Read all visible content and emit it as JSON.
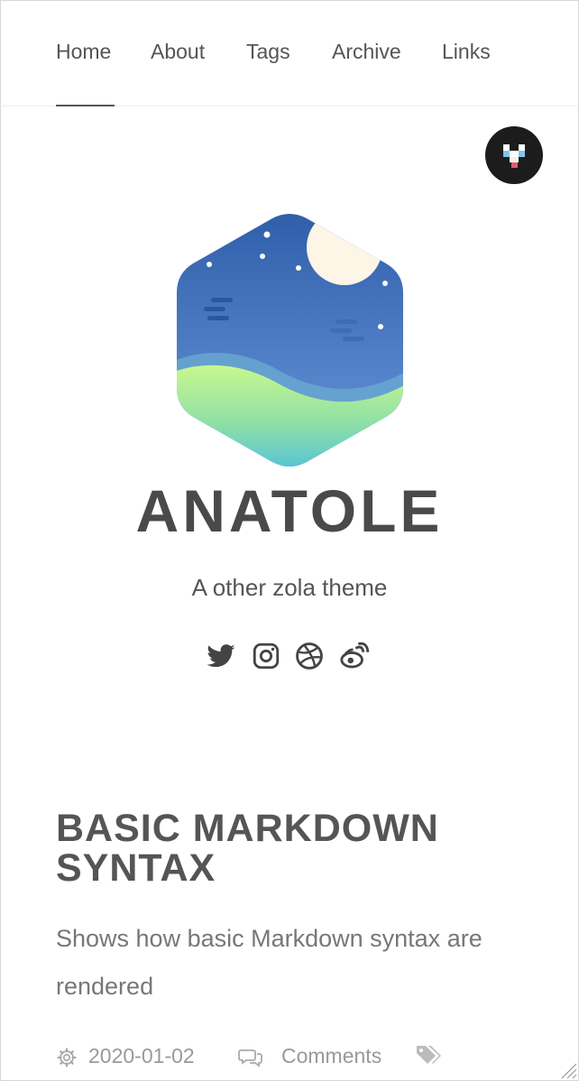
{
  "nav": {
    "items": [
      {
        "label": "Home",
        "active": true
      },
      {
        "label": "About"
      },
      {
        "label": "Tags"
      },
      {
        "label": "Archive"
      },
      {
        "label": "Links"
      }
    ]
  },
  "theme_toggle": {
    "icon": "theme-toggle-icon"
  },
  "site": {
    "title": "ANATOLE",
    "description": "A other zola theme",
    "social": [
      "twitter-icon",
      "instagram-icon",
      "dribbble-icon",
      "weibo-icon"
    ]
  },
  "post": {
    "title": "BASIC MARKDOWN SYNTAX",
    "summary": "Shows how basic Markdown syntax are rendered",
    "date": "2020-01-02",
    "comments_label": "Comments"
  },
  "colors": {
    "text": "#555555",
    "muted": "#999999",
    "toggle_bg": "#1c1c1c",
    "sky_top": "#2f5ea9",
    "sky_bottom": "#5a8ad6",
    "moon": "#fdf5e6",
    "grass_top": "#c5f590",
    "grass_bottom": "#58c7d4"
  }
}
